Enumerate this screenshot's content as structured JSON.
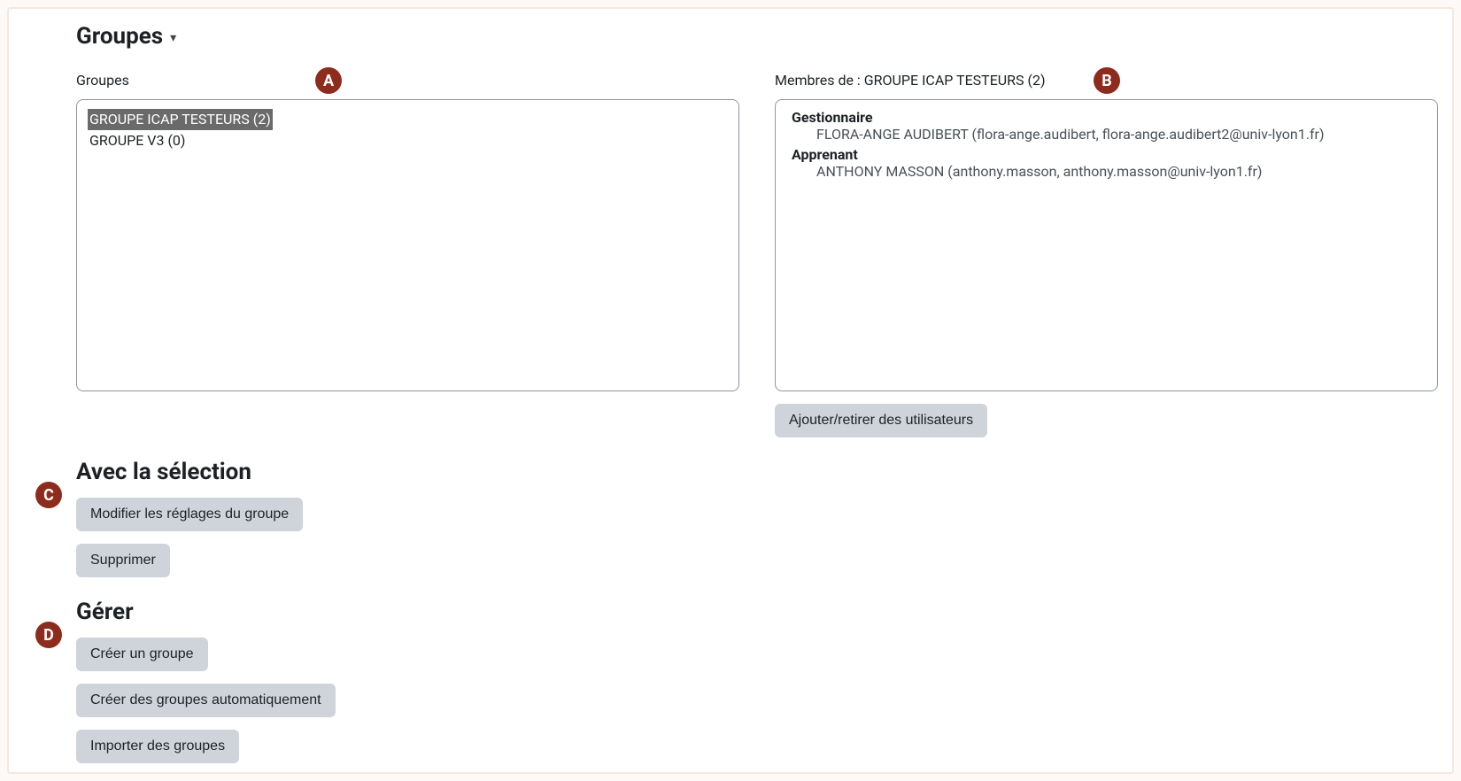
{
  "page": {
    "title": "Groupes"
  },
  "markers": {
    "a": "A",
    "b": "B",
    "c": "C",
    "d": "D"
  },
  "left": {
    "label": "Groupes",
    "items": [
      {
        "label": "GROUPE ICAP TESTEURS (2)",
        "selected": true
      },
      {
        "label": "GROUPE V3 (0)",
        "selected": false
      }
    ]
  },
  "right": {
    "label": "Membres de : GROUPE ICAP TESTEURS (2)",
    "roles": [
      {
        "role": "Gestionnaire",
        "members": [
          "FLORA-ANGE AUDIBERT (flora-ange.audibert, flora-ange.audibert2@univ-lyon1.fr)"
        ]
      },
      {
        "role": "Apprenant",
        "members": [
          "ANTHONY MASSON (anthony.masson, anthony.masson@univ-lyon1.fr)"
        ]
      }
    ],
    "button": "Ajouter/retirer des utilisateurs"
  },
  "selection": {
    "heading": "Avec la sélection",
    "edit": "Modifier les réglages du groupe",
    "delete": "Supprimer"
  },
  "manage": {
    "heading": "Gérer",
    "create": "Créer un groupe",
    "auto": "Créer des groupes automatiquement",
    "import": "Importer des groupes"
  }
}
